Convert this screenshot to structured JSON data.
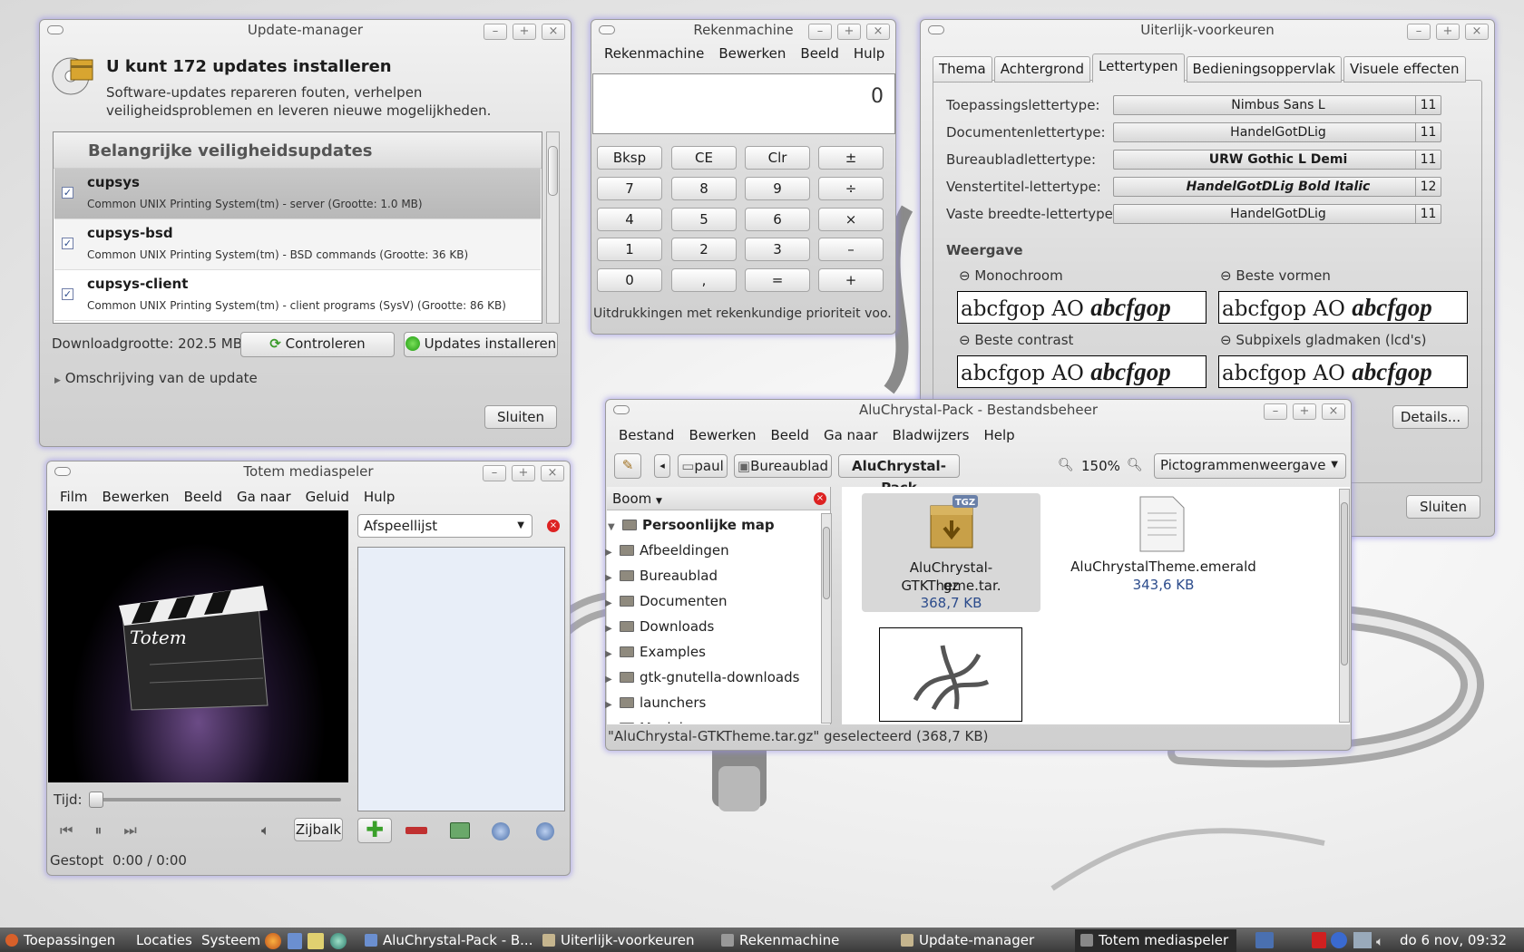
{
  "update_manager": {
    "title": "Update-manager",
    "heading": "U kunt 172 updates installeren",
    "description": "Software-updates repareren fouten, verhelpen veiligheidsproblemen en leveren nieuwe mogelijkheden.",
    "section_header": "Belangrijke veiligheidsupdates",
    "updates": [
      {
        "name": "cupsys",
        "desc": "Common UNIX Printing System(tm) - server (Grootte: 1.0 MB)",
        "checked": true
      },
      {
        "name": "cupsys-bsd",
        "desc": "Common UNIX Printing System(tm) - BSD commands (Grootte: 36 KB)",
        "checked": true
      },
      {
        "name": "cupsys-client",
        "desc": "Common UNIX Printing System(tm) - client programs (SysV) (Grootte: 86 KB)",
        "checked": true
      }
    ],
    "download_size": "Downloadgrootte: 202.5 MB",
    "check_button": "Controleren",
    "install_button": "Updates installeren",
    "expander": "Omschrijving van de update",
    "close_button": "Sluiten"
  },
  "calculator": {
    "title": "Rekenmachine",
    "menu": [
      "Rekenmachine",
      "Bewerken",
      "Beeld",
      "Hulp"
    ],
    "display": "0",
    "buttons": [
      [
        "Bksp",
        "CE",
        "Clr",
        "±"
      ],
      [
        "7",
        "8",
        "9",
        "÷"
      ],
      [
        "4",
        "5",
        "6",
        "×"
      ],
      [
        "1",
        "2",
        "3",
        "–"
      ],
      [
        "0",
        ",",
        "=",
        "+"
      ]
    ],
    "status": "Uitdrukkingen met rekenkundige prioriteit voo..."
  },
  "appearance": {
    "title": "Uiterlijk-voorkeuren",
    "tabs": [
      "Thema",
      "Achtergrond",
      "Lettertypen",
      "Bedieningsoppervlak",
      "Visuele effecten"
    ],
    "active_tab": 2,
    "fonts": [
      {
        "label": "Toepassingslettertype:",
        "font": "Nimbus Sans L",
        "size": "11"
      },
      {
        "label": "Documentenlettertype:",
        "font": "HandelGotDLig",
        "size": "11"
      },
      {
        "label": "Bureaubladlettertype:",
        "font": "URW Gothic L Demi",
        "size": "11"
      },
      {
        "label": "Venstertitel-lettertype:",
        "font": "HandelGotDLig Bold Italic",
        "size": "12"
      },
      {
        "label": "Vaste breedte-lettertype:",
        "font": "HandelGotDLig",
        "size": "11"
      }
    ],
    "rendering_heading": "Weergave",
    "options": [
      "Monochroom",
      "Beste vormen",
      "Beste contrast",
      "Subpixels gladmaken (lcd's)"
    ],
    "sample_text": "abcfgop AO ",
    "sample_italic": "abcfgop",
    "details_button": "Details...",
    "close_button": "Sluiten"
  },
  "file_manager": {
    "title": "AluChrystal-Pack - Bestandsbeheer",
    "menu": [
      "Bestand",
      "Bewerken",
      "Beeld",
      "Ga naar",
      "Bladwijzers",
      "Help"
    ],
    "path": [
      "paul",
      "Bureaublad",
      "AluChrystal-Pack"
    ],
    "zoom": "150%",
    "view_mode": "Pictogrammenweergave",
    "sidebar_mode": "Boom",
    "tree_root": "Persoonlijke map",
    "tree": [
      "Afbeeldingen",
      "Bureaublad",
      "Documenten",
      "Downloads",
      "Examples",
      "gtk-gnutella-downloads",
      "launchers",
      "Muziek"
    ],
    "files": [
      {
        "name": "AluChrystal-GTKTheme.tar.gz",
        "name_line1": "AluChrystal-GTKTheme.tar.",
        "name_line2": "gz",
        "size": "368,7 KB",
        "badge": "TGZ"
      },
      {
        "name": "AluChrystalTheme.emerald",
        "size": "343,6 KB"
      }
    ],
    "status": "\"AluChrystal-GTKTheme.tar.gz\" geselecteerd (368,7 KB)"
  },
  "totem": {
    "title": "Totem mediaspeler",
    "menu": [
      "Film",
      "Bewerken",
      "Beeld",
      "Ga naar",
      "Geluid",
      "Hulp"
    ],
    "logo_text": "Totem",
    "playlist_select": "Afspeellijst",
    "time_label": "Tijd:",
    "sidebar_button": "Zijbalk",
    "status": "Gestopt",
    "time": "0:00 / 0:00",
    "seek_fraction": 0
  },
  "taskbar": {
    "menus": [
      "Toepassingen",
      "Locaties",
      "Systeem"
    ],
    "tasks": [
      "AluChrystal-Pack - B...",
      "Uiterlijk-voorkeuren",
      "Rekenmachine",
      "Update-manager",
      "Totem mediaspeler"
    ],
    "active_task": 4,
    "clock": "do  6 nov, 09:32"
  }
}
